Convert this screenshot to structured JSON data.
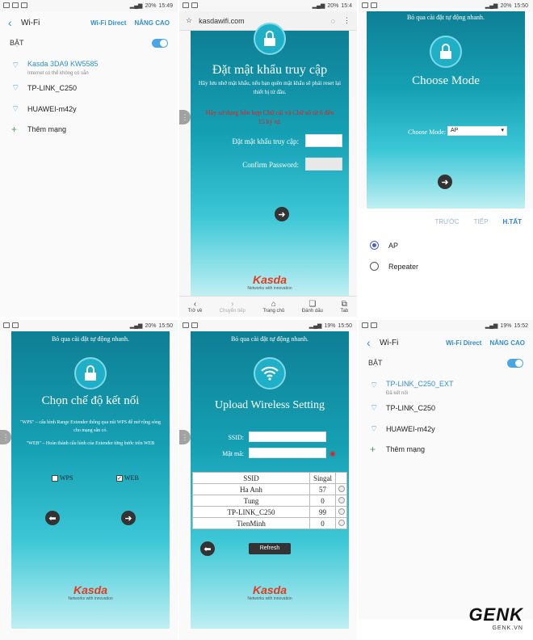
{
  "panel1": {
    "status": {
      "battery": "20%",
      "time": "15:49"
    },
    "title": "Wi-Fi",
    "wifi_direct": "Wi-Fi Direct",
    "advanced": "NÂNG CAO",
    "on_label": "BẬT",
    "networks": [
      {
        "name": "Kasda 3DA9 KW5585",
        "sub": "Internet có thể không có sẵn"
      },
      {
        "name": "TP-LINK_C250",
        "sub": ""
      },
      {
        "name": "HUAWEI-m42y",
        "sub": ""
      }
    ],
    "add_network": "Thêm mạng"
  },
  "panel2": {
    "status": {
      "battery": "20%",
      "time": "15:4"
    },
    "url": "kasdawifi.com",
    "title": "Đặt mật khẩu truy cập",
    "desc": "Hãy lưu nhớ mật khẩu, nếu bạn quên mật khẩu sẽ phải reset lại thiết bị từ đầu.",
    "warn": "Hãy sử dụng hỗn hợp Chữ cái và Chữ số từ 6 đến 15 ký tự.",
    "pw_label": "Đặt mật khẩu truy cập:",
    "confirm_label": "Confirm Password:",
    "nav": {
      "back": "Trở về",
      "forward": "Chuyển tiếp",
      "home": "Trang chủ",
      "bookmarks": "Đánh dấu",
      "tabs": "Tab"
    },
    "logo": "Kasda",
    "logo_tag": "Networks with innovation"
  },
  "panel3": {
    "status": {
      "battery": "20%",
      "time": "15:50"
    },
    "skip": "Bỏ qua cài đặt tự động nhanh.",
    "title": "Choose Mode",
    "mode_label": "Choose Mode:",
    "mode_value": "AP",
    "dialog": {
      "prev": "TRƯỚC",
      "next": "TIẾP",
      "done": "H.TẤT",
      "options": [
        "AP",
        "Repeater"
      ],
      "selected": "AP"
    }
  },
  "panel4": {
    "status": {
      "battery": "20%",
      "time": "15:50"
    },
    "skip": "Bỏ qua cài đặt tự động nhanh.",
    "title": "Chọn chế độ kết nối",
    "wps_desc": "\"WPS\" – cấu hình Range Extender thông qua nút WPS để mở rộng sóng cho mạng sẵn có.",
    "web_desc": "\"WEB\" – Hoàn thành cấu hình của Extender từng bước trên WEB",
    "wps_label": "WPS",
    "web_label": "WEB",
    "logo": "Kasda",
    "logo_tag": "Networks with innovation"
  },
  "panel5": {
    "status": {
      "battery": "19%",
      "time": "15:50"
    },
    "skip": "Bỏ qua cài đặt tự động nhanh.",
    "title": "Upload Wireless Setting",
    "ssid_label": "SSID:",
    "pw_label": "Mật mã:",
    "table_headers": [
      "SSID",
      "Singal"
    ],
    "rows": [
      {
        "ssid": "Ha Anh",
        "signal": "57"
      },
      {
        "ssid": "Tung",
        "signal": "0"
      },
      {
        "ssid": "TP-LINK_C250",
        "signal": "99"
      },
      {
        "ssid": "TienMinh",
        "signal": "0"
      }
    ],
    "refresh": "Refresh",
    "logo": "Kasda",
    "logo_tag": "Networks with innovation"
  },
  "panel6": {
    "status": {
      "battery": "19%",
      "time": "15:52"
    },
    "title": "Wi-Fi",
    "wifi_direct": "Wi-Fi Direct",
    "advanced": "NÂNG CAO",
    "on_label": "BẬT",
    "networks": [
      {
        "name": "TP-LINK_C250_EXT",
        "sub": "Đã kết nối"
      },
      {
        "name": "TP-LINK_C250",
        "sub": ""
      },
      {
        "name": "HUAWEI-m42y",
        "sub": ""
      }
    ],
    "add_network": "Thêm mạng"
  },
  "watermark": {
    "brand": "GENK",
    "domain": "GENK.VN"
  }
}
